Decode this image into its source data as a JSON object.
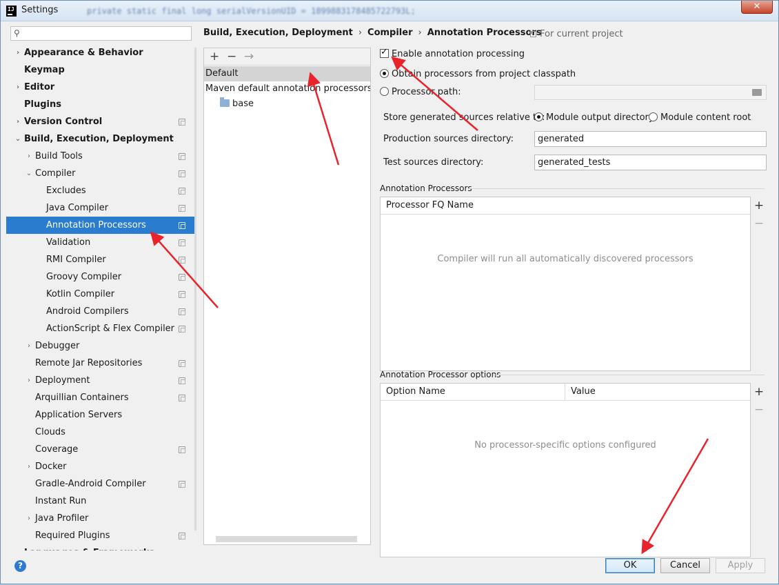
{
  "window": {
    "title": "Settings",
    "blurred_title": "private static final long serialVersionUID = 1899883178485722793L;",
    "app_icon": "intellij-icon",
    "close_label": "✕"
  },
  "search": {
    "placeholder": "",
    "icon": "search-icon"
  },
  "sidebar": {
    "items": [
      {
        "label": "Appearance & Behavior",
        "bold": true,
        "expander": "›",
        "depth": 0,
        "proj": false
      },
      {
        "label": "Keymap",
        "bold": true,
        "expander": "",
        "depth": 0,
        "proj": false
      },
      {
        "label": "Editor",
        "bold": true,
        "expander": "›",
        "depth": 0,
        "proj": false
      },
      {
        "label": "Plugins",
        "bold": true,
        "expander": "",
        "depth": 0,
        "proj": false
      },
      {
        "label": "Version Control",
        "bold": true,
        "expander": "›",
        "depth": 0,
        "proj": true
      },
      {
        "label": "Build, Execution, Deployment",
        "bold": true,
        "expander": "⌄",
        "depth": 0,
        "proj": false
      },
      {
        "label": "Build Tools",
        "bold": false,
        "expander": "›",
        "depth": 1,
        "proj": true
      },
      {
        "label": "Compiler",
        "bold": false,
        "expander": "⌄",
        "depth": 1,
        "proj": true
      },
      {
        "label": "Excludes",
        "bold": false,
        "expander": "",
        "depth": 2,
        "proj": true
      },
      {
        "label": "Java Compiler",
        "bold": false,
        "expander": "",
        "depth": 2,
        "proj": true
      },
      {
        "label": "Annotation Processors",
        "bold": false,
        "expander": "",
        "depth": 2,
        "proj": true,
        "selected": true
      },
      {
        "label": "Validation",
        "bold": false,
        "expander": "",
        "depth": 2,
        "proj": true
      },
      {
        "label": "RMI Compiler",
        "bold": false,
        "expander": "",
        "depth": 2,
        "proj": true
      },
      {
        "label": "Groovy Compiler",
        "bold": false,
        "expander": "",
        "depth": 2,
        "proj": true
      },
      {
        "label": "Kotlin Compiler",
        "bold": false,
        "expander": "",
        "depth": 2,
        "proj": true
      },
      {
        "label": "Android Compilers",
        "bold": false,
        "expander": "",
        "depth": 2,
        "proj": true
      },
      {
        "label": "ActionScript & Flex Compiler",
        "bold": false,
        "expander": "",
        "depth": 2,
        "proj": true
      },
      {
        "label": "Debugger",
        "bold": false,
        "expander": "›",
        "depth": 1,
        "proj": false
      },
      {
        "label": "Remote Jar Repositories",
        "bold": false,
        "expander": "",
        "depth": 1,
        "proj": true
      },
      {
        "label": "Deployment",
        "bold": false,
        "expander": "›",
        "depth": 1,
        "proj": true
      },
      {
        "label": "Arquillian Containers",
        "bold": false,
        "expander": "",
        "depth": 1,
        "proj": true
      },
      {
        "label": "Application Servers",
        "bold": false,
        "expander": "",
        "depth": 1,
        "proj": false
      },
      {
        "label": "Clouds",
        "bold": false,
        "expander": "",
        "depth": 1,
        "proj": false
      },
      {
        "label": "Coverage",
        "bold": false,
        "expander": "",
        "depth": 1,
        "proj": true
      },
      {
        "label": "Docker",
        "bold": false,
        "expander": "›",
        "depth": 1,
        "proj": false
      },
      {
        "label": "Gradle-Android Compiler",
        "bold": false,
        "expander": "",
        "depth": 1,
        "proj": true
      },
      {
        "label": "Instant Run",
        "bold": false,
        "expander": "",
        "depth": 1,
        "proj": false
      },
      {
        "label": "Java Profiler",
        "bold": false,
        "expander": "›",
        "depth": 1,
        "proj": false
      },
      {
        "label": "Required Plugins",
        "bold": false,
        "expander": "",
        "depth": 1,
        "proj": true
      },
      {
        "label": "Languages & Frameworks",
        "bold": true,
        "expander": "›",
        "depth": 0,
        "proj": false
      }
    ]
  },
  "breadcrumb": {
    "part1": "Build, Execution, Deployment",
    "part2": "Compiler",
    "part3": "Annotation Processors",
    "separator": "›"
  },
  "for_current_project": "For current project",
  "profiles": {
    "add_label": "+",
    "remove_label": "−",
    "move_label": "→",
    "default_profile": "Default",
    "maven_profile": "Maven default annotation processors profile",
    "module": "base"
  },
  "settings": {
    "enable_annotation_processing": "Enable annotation processing",
    "enable_checked": true,
    "obtain_from_classpath": "Obtain processors from project classpath",
    "processor_path": "Processor path:",
    "processor_path_value": "",
    "store_relative_label": "Store generated sources relative to:",
    "module_output_dir": "Module output directory",
    "module_content_root": "Module content root",
    "production_dir_label": "Production sources directory:",
    "production_dir_value": "generated",
    "test_dir_label": "Test sources directory:",
    "test_dir_value": "generated_tests"
  },
  "annotation_processors": {
    "section_title": "Annotation Processors",
    "column": "Processor FQ Name",
    "empty_text": "Compiler will run all automatically discovered processors",
    "add_label": "+",
    "remove_label": "−"
  },
  "processor_options": {
    "section_title": "Annotation Processor options",
    "columns": [
      "Option Name",
      "Value"
    ],
    "empty_text": "No processor-specific options configured",
    "add_label": "+",
    "remove_label": "−"
  },
  "footer": {
    "help_label": "?",
    "ok_label": "OK",
    "cancel_label": "Cancel",
    "apply_label": "Apply"
  },
  "colors": {
    "selection": "#2a7ccf",
    "annotation_arrow": "#e8232b"
  }
}
